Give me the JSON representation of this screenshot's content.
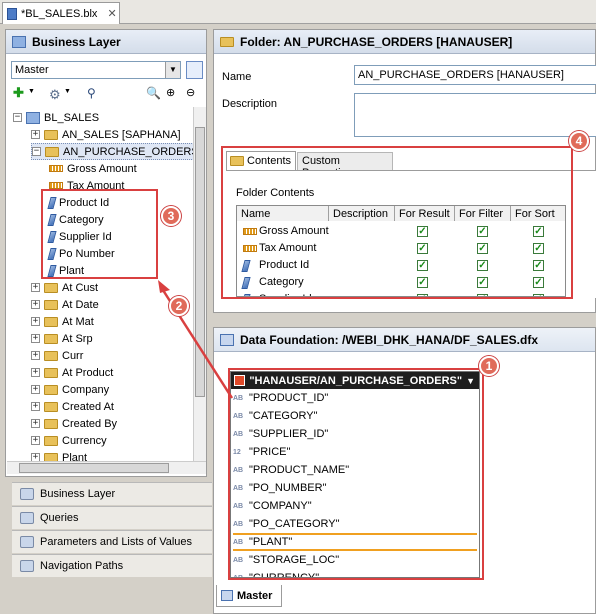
{
  "file_tab": {
    "label": "*BL_SALES.blx"
  },
  "left_panel": {
    "title": "Business Layer",
    "dropdown_value": "Master"
  },
  "tree": {
    "root": "BL_SALES",
    "items": [
      {
        "label": "AN_SALES [SAPHANA]",
        "type": "folder",
        "expanded": false
      },
      {
        "label": "AN_PURCHASE_ORDERS",
        "type": "folder",
        "expanded": true,
        "selected": true
      },
      {
        "label": "Gross Amount",
        "type": "measure"
      },
      {
        "label": "Tax Amount",
        "type": "measure"
      },
      {
        "label": "Product Id",
        "type": "dimension"
      },
      {
        "label": "Category",
        "type": "dimension"
      },
      {
        "label": "Supplier Id",
        "type": "dimension"
      },
      {
        "label": "Po Number",
        "type": "dimension"
      },
      {
        "label": "Plant",
        "type": "dimension"
      },
      {
        "label": "At Cust",
        "type": "folder"
      },
      {
        "label": "At Date",
        "type": "folder"
      },
      {
        "label": "At Mat",
        "type": "folder"
      },
      {
        "label": "At Srp",
        "type": "folder"
      },
      {
        "label": "Curr",
        "type": "folder"
      },
      {
        "label": "At Product",
        "type": "folder"
      },
      {
        "label": "Company",
        "type": "folder"
      },
      {
        "label": "Created At",
        "type": "folder"
      },
      {
        "label": "Created By",
        "type": "folder"
      },
      {
        "label": "Currency",
        "type": "folder"
      },
      {
        "label": "Plant",
        "type": "folder"
      }
    ]
  },
  "nav": {
    "items": [
      "Business Layer",
      "Queries",
      "Parameters and Lists of Values",
      "Navigation Paths"
    ]
  },
  "folder_panel": {
    "title": "Folder: AN_PURCHASE_ORDERS [HANAUSER]",
    "name_label": "Name",
    "name_value": "AN_PURCHASE_ORDERS [HANAUSER]",
    "description_label": "Description",
    "tabs": [
      "Contents",
      "Custom Properties"
    ],
    "contents_label": "Folder Contents",
    "columns": [
      "Name",
      "Description",
      "For Result",
      "For Filter",
      "For Sort"
    ],
    "rows": [
      {
        "name": "Gross Amount",
        "type": "measure"
      },
      {
        "name": "Tax Amount",
        "type": "measure"
      },
      {
        "name": "Product Id",
        "type": "dimension"
      },
      {
        "name": "Category",
        "type": "dimension"
      },
      {
        "name": "Supplier Id",
        "type": "dimension"
      }
    ]
  },
  "data_foundation": {
    "title": "Data Foundation: /WEBI_DHK_HANA/DF_SALES.dfx",
    "table_name": "\"HANAUSER/AN_PURCHASE_ORDERS\"",
    "columns": [
      {
        "type": "AB",
        "name": "\"PRODUCT_ID\""
      },
      {
        "type": "AB",
        "name": "\"CATEGORY\""
      },
      {
        "type": "AB",
        "name": "\"SUPPLIER_ID\""
      },
      {
        "type": "12",
        "name": "\"PRICE\""
      },
      {
        "type": "AB",
        "name": "\"PRODUCT_NAME\""
      },
      {
        "type": "AB",
        "name": "\"PO_NUMBER\""
      },
      {
        "type": "AB",
        "name": "\"COMPANY\""
      },
      {
        "type": "AB",
        "name": "\"PO_CATEGORY\""
      },
      {
        "type": "AB",
        "name": "\"PLANT\""
      },
      {
        "type": "AB",
        "name": "\"STORAGE_LOC\""
      },
      {
        "type": "AB",
        "name": "\"CURRENCY\""
      }
    ],
    "bottom_tab": "Master"
  },
  "callouts": [
    "1",
    "2",
    "3",
    "4"
  ],
  "colors": {
    "callout": "#d94040",
    "header_bg": "#dfe6f1",
    "table_header": "#1f1f1f"
  }
}
